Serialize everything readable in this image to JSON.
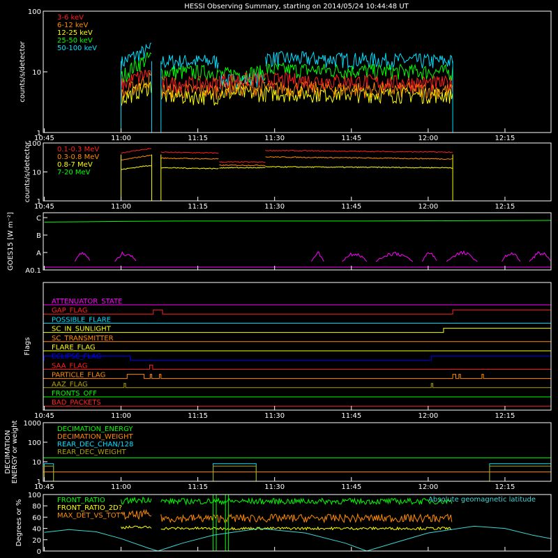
{
  "title": "HESSI Observing Summary, starting on 2014/05/24 10:44:48 UT",
  "time_ticks": [
    "10:45",
    "11:00",
    "11:15",
    "11:30",
    "11:45",
    "12:00",
    "12:15"
  ],
  "colors": {
    "red": "#ff2020",
    "orange": "#ff8c00",
    "yellow": "#ffff00",
    "green": "#00ff00",
    "cyan": "#00e0ff",
    "magenta": "#ff00ff",
    "blue": "#0000ff",
    "olive": "#b0a000",
    "teal": "#3ad8d8",
    "frame": "#ffffff"
  },
  "chart_data": [
    {
      "id": "lightcurves_low",
      "type": "line",
      "ylabel": "counts/s/detector",
      "yscale": "log",
      "ylim": [
        1,
        100
      ],
      "ytick_labels": [
        "1",
        "10",
        "100"
      ],
      "xlim": [
        10.7467,
        12.4
      ],
      "x_unit": "UT hours",
      "legend": "top-left",
      "series": [
        {
          "name": "3-6 keV",
          "color": "red",
          "segments": [
            [
              11.0,
              11.1,
              6,
              10
            ],
            [
              11.13,
              11.32,
              6.5,
              6.5
            ],
            [
              11.32,
              11.47,
              7.5,
              7.5
            ],
            [
              11.47,
              12.08,
              7.5,
              6.5
            ]
          ]
        },
        {
          "name": "6-12 keV",
          "color": "orange",
          "segments": [
            [
              11.0,
              11.1,
              4,
              8
            ],
            [
              11.13,
              11.32,
              5,
              5
            ],
            [
              11.32,
              11.47,
              5.5,
              5.5
            ],
            [
              11.47,
              12.08,
              5.5,
              5
            ]
          ]
        },
        {
          "name": "12-25 keV",
          "color": "yellow",
          "segments": [
            [
              11.0,
              11.1,
              3.5,
              6
            ],
            [
              11.13,
              11.32,
              4,
              4
            ],
            [
              11.32,
              11.47,
              4.5,
              4.5
            ],
            [
              11.47,
              12.08,
              4.5,
              4.2
            ]
          ]
        },
        {
          "name": "25-50 keV",
          "color": "green",
          "segments": [
            [
              11.0,
              11.1,
              8,
              18
            ],
            [
              11.13,
              11.32,
              10,
              10
            ],
            [
              11.32,
              11.47,
              9,
              10
            ],
            [
              11.47,
              12.08,
              11,
              10
            ]
          ]
        },
        {
          "name": "50-100 keV",
          "color": "cyan",
          "segments": [
            [
              11.0,
              11.1,
              14,
              24
            ],
            [
              11.13,
              11.32,
              15,
              15
            ],
            [
              11.32,
              11.47,
              7,
              8
            ],
            [
              11.47,
              12.08,
              17,
              15
            ]
          ]
        }
      ]
    },
    {
      "id": "lightcurves_high",
      "type": "line",
      "ylabel": "counts/s/detector",
      "yscale": "log",
      "ylim": [
        1,
        100
      ],
      "ytick_labels": [
        "1",
        "10",
        "100"
      ],
      "legend": "top-left",
      "series": [
        {
          "name": "0.1-0.3 MeV",
          "color": "red",
          "segments": [
            [
              11.0,
              11.1,
              45,
              65
            ],
            [
              11.13,
              11.32,
              48,
              45
            ],
            [
              11.32,
              11.47,
              22,
              22
            ],
            [
              11.47,
              12.08,
              55,
              48
            ]
          ]
        },
        {
          "name": "0.3-0.8 MeV",
          "color": "orange",
          "segments": [
            [
              11.0,
              11.1,
              25,
              38
            ],
            [
              11.13,
              11.32,
              30,
              28
            ],
            [
              11.32,
              11.47,
              17,
              17
            ],
            [
              11.47,
              12.08,
              33,
              28
            ]
          ]
        },
        {
          "name": "0.8-7 MeV",
          "color": "yellow",
          "segments": [
            [
              11.0,
              11.1,
              12,
              17
            ],
            [
              11.13,
              11.32,
              14,
              13
            ],
            [
              11.32,
              11.47,
              14,
              14
            ],
            [
              11.47,
              12.08,
              15,
              14
            ]
          ]
        },
        {
          "name": "7-20 MeV",
          "color": "green",
          "segments": []
        }
      ]
    },
    {
      "id": "goes",
      "type": "line",
      "ylabel": "GOES15 [W m⁻²]",
      "ytick_labels": [
        "A0.1",
        "A",
        "B",
        "C"
      ],
      "series": [
        {
          "name": "long",
          "color": "green",
          "values": [
            [
              10.75,
              2.78
            ],
            [
              11.0,
              2.82
            ],
            [
              11.2,
              2.84
            ],
            [
              11.5,
              2.84
            ],
            [
              11.8,
              2.84
            ],
            [
              12.0,
              2.86
            ],
            [
              12.4,
              2.88
            ]
          ]
        },
        {
          "name": "short",
          "color": "magenta",
          "values": []
        }
      ]
    },
    {
      "id": "flags",
      "type": "line",
      "ylabel": "Flags",
      "series": [
        {
          "name": "ATTENUATOR_STATE",
          "color": "magenta",
          "steps": []
        },
        {
          "name": "GAP_FLAG",
          "color": "red",
          "steps": [
            [
              11.105,
              11.135
            ],
            [
              12.08,
              12.4
            ]
          ]
        },
        {
          "name": "POSSIBLE_FLARE",
          "color": "cyan",
          "steps": []
        },
        {
          "name": "SC_IN_SUNLIGHT",
          "color": "yellow",
          "steps": [
            [
              10.75,
              11.02
            ],
            [
              12.05,
              12.4
            ]
          ],
          "inverted": true
        },
        {
          "name": "SC_TRANSMITTER",
          "color": "orange",
          "steps": []
        },
        {
          "name": "FLARE_FLAG",
          "color": "yellow",
          "steps": []
        },
        {
          "name": "ECLIPSE_FLAG",
          "color": "blue",
          "steps": [
            [
              10.75,
              11.03
            ],
            [
              12.01,
              12.4
            ]
          ]
        },
        {
          "name": "SAA_FLAG",
          "color": "red",
          "steps": [
            [
              11.093,
              11.103
            ]
          ]
        },
        {
          "name": "PARTICLE_FLAG",
          "color": "orange",
          "steps": [
            [
              11.02,
              11.075
            ],
            [
              11.095,
              11.1
            ],
            [
              11.125,
              11.13
            ],
            [
              12.08,
              12.09
            ],
            [
              12.1,
              12.105
            ],
            [
              12.175,
              12.18
            ]
          ]
        },
        {
          "name": "AAZ_FLAG",
          "color": "olive",
          "steps": [
            [
              11.01,
              11.015
            ],
            [
              12.01,
              12.015
            ]
          ]
        },
        {
          "name": "FRONTS_OFF",
          "color": "green",
          "steps": []
        },
        {
          "name": "BAD_PACKETS",
          "color": "red",
          "steps": []
        }
      ]
    },
    {
      "id": "decimation",
      "type": "line",
      "ylabel": "DECIMATION ENERGY or weight",
      "yscale": "log",
      "ylim": [
        1,
        1000
      ],
      "ytick_labels": [
        "1",
        "10",
        "100",
        "1000"
      ],
      "legend": "top-left",
      "series": [
        {
          "name": "DECIMATION_ENERGY",
          "color": "green",
          "value": 16
        },
        {
          "name": "DECIMATION_WEIGHT",
          "color": "orange",
          "value": 3
        },
        {
          "name": "REAR_DEC_CHAN/128",
          "color": "cyan",
          "steps": [
            [
              10.75,
              10.78,
              8
            ],
            [
              11.3,
              11.44,
              8
            ],
            [
              12.2,
              12.4,
              8
            ]
          ]
        },
        {
          "name": "REAR_DEC_WEIGHT",
          "color": "olive",
          "steps": [
            [
              10.75,
              10.78,
              6
            ],
            [
              11.3,
              11.44,
              6
            ],
            [
              12.2,
              12.4,
              6
            ]
          ]
        }
      ]
    },
    {
      "id": "ratios",
      "type": "line",
      "ylabel": "Degrees or %",
      "ylim": [
        0,
        100
      ],
      "ytick_labels": [
        "0",
        "20",
        "40",
        "60",
        "80",
        "100"
      ],
      "legend": "top-left",
      "series": [
        {
          "name": "FRONT_RATIO",
          "color": "green",
          "segments": [
            [
              11.0,
              11.1,
              88,
              92
            ],
            [
              11.13,
              12.08,
              88,
              88
            ]
          ]
        },
        {
          "name": "FRONT_RATIO_SLOT",
          "label": "FRONT_RATIO_2D?",
          "color": "yellow",
          "segments": [
            [
              11.0,
              11.1,
              42,
              42
            ],
            [
              11.13,
              12.08,
              40,
              40
            ]
          ]
        },
        {
          "name": "MAX_DET_VS_TOT",
          "color": "orange",
          "segments": [
            [
              11.0,
              11.1,
              62,
              65
            ],
            [
              11.13,
              12.08,
              58,
              58
            ]
          ]
        },
        {
          "name": "Absolute geomagnetic latitude",
          "color": "teal",
          "values": [
            [
              10.75,
              33
            ],
            [
              10.83,
              38
            ],
            [
              10.92,
              34
            ],
            [
              11.0,
              22
            ],
            [
              11.09,
              5
            ],
            [
              11.12,
              0
            ],
            [
              11.2,
              14
            ],
            [
              11.3,
              28
            ],
            [
              11.45,
              40
            ],
            [
              11.6,
              32
            ],
            [
              11.73,
              14
            ],
            [
              11.8,
              0
            ],
            [
              11.9,
              16
            ],
            [
              12.0,
              32
            ],
            [
              12.15,
              44
            ],
            [
              12.25,
              40
            ],
            [
              12.34,
              28
            ],
            [
              12.4,
              22
            ]
          ]
        }
      ]
    }
  ]
}
